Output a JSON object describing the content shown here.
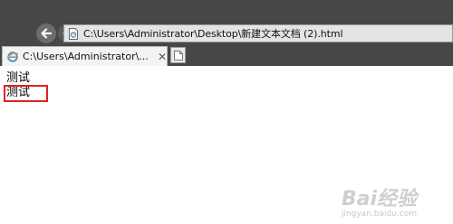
{
  "browser": {
    "address_bar": {
      "url": "C:\\Users\\Administrator\\Desktop\\新建文本文档 (2).html",
      "icon": "page-icon"
    },
    "back_icon": "arrow-left-icon",
    "forward_icon": "arrow-right-icon",
    "tabs": [
      {
        "label": "C:\\Users\\Administrator\\...",
        "close": "✕",
        "icon": "ie-icon"
      }
    ],
    "new_tab_icon": "new-tab-icon"
  },
  "page": {
    "lines": [
      "测试",
      "测试"
    ]
  },
  "watermark": {
    "text": "Bai经验",
    "sub": "jingyan.baidu.com"
  },
  "colors": {
    "chrome_bg": "#474747",
    "highlight": "#e02020"
  }
}
